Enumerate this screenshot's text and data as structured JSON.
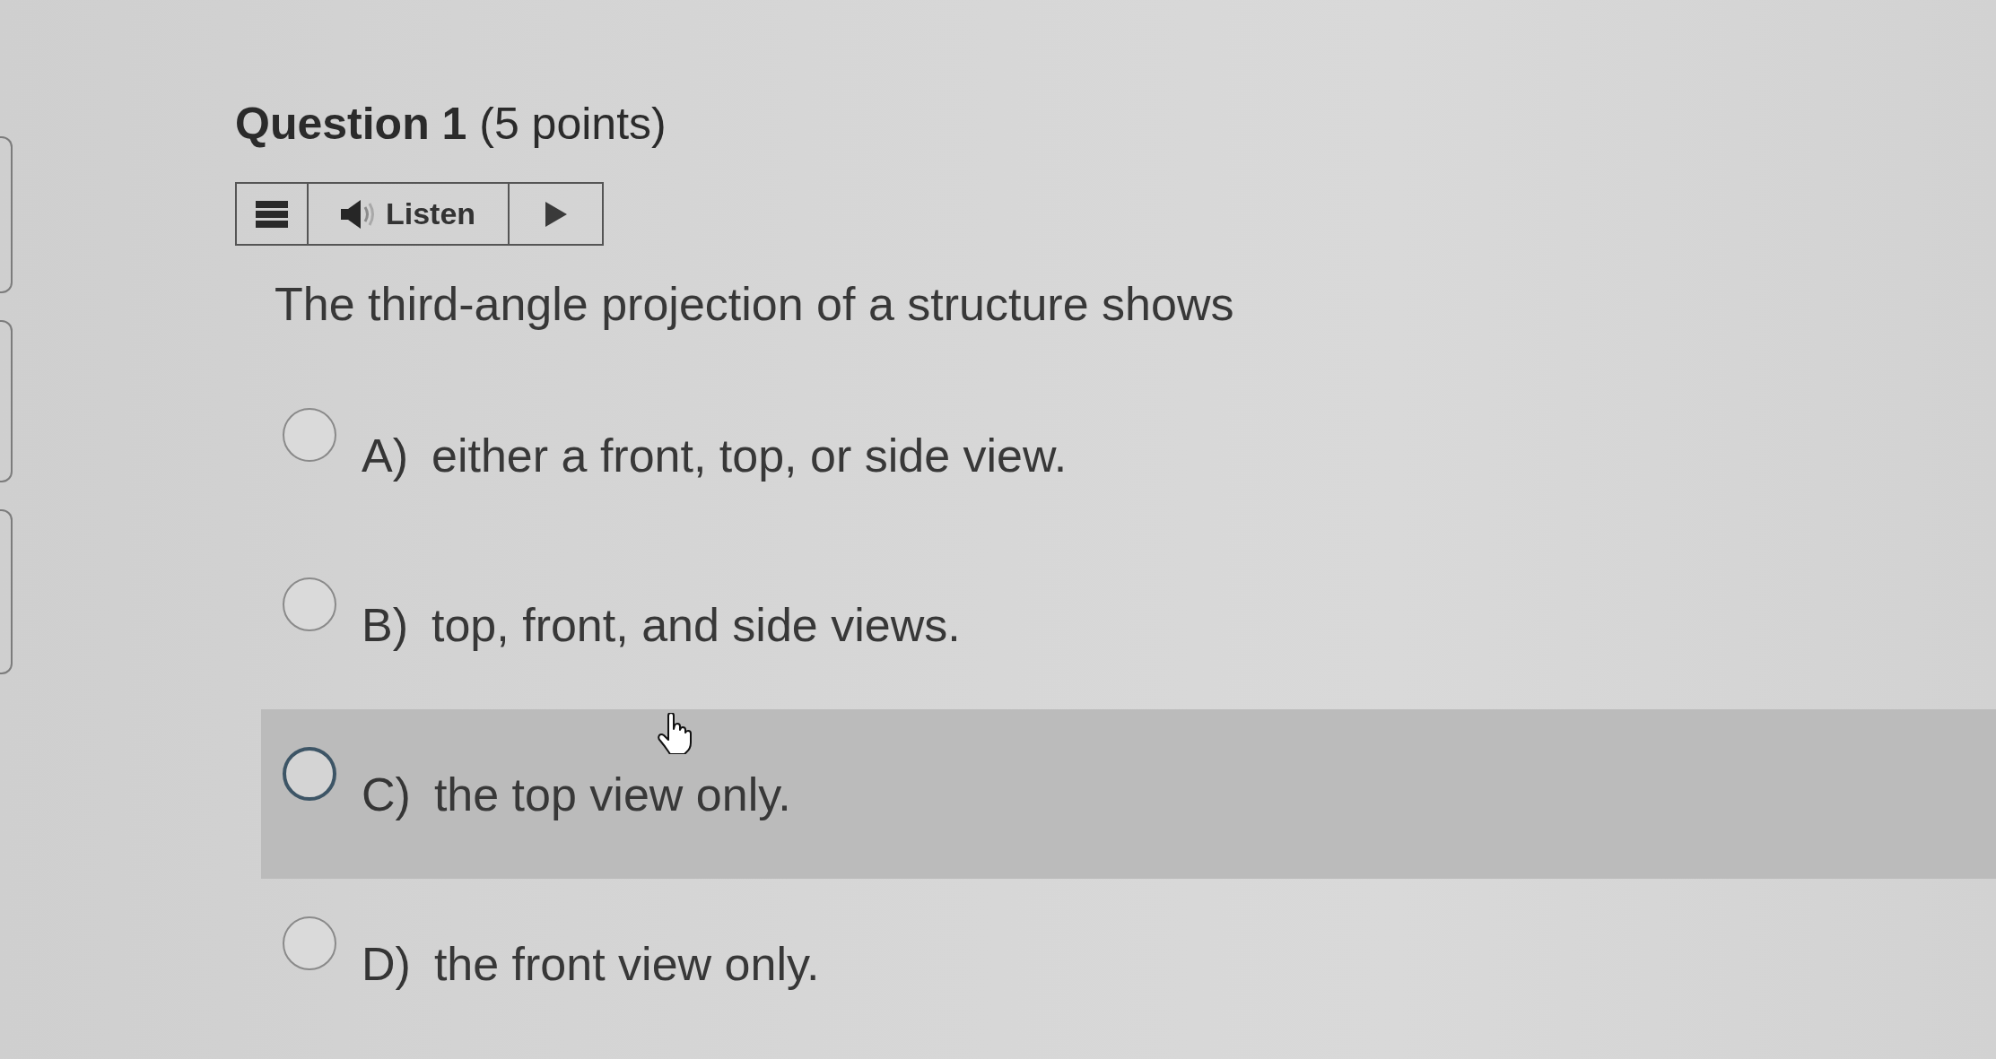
{
  "question": {
    "title": "**Question 1** (5 points)",
    "toolbar": [
      {
        "kind": "menu"
      },
      {
        "kind": "listen",
        "label": "Listen"
      },
      {
        "kind": "play"
      }
    ],
    "prompt": "The third-angle projection of a structure shows",
    "options": [
      {
        "label": "A)",
        "text": "either a front, top, or side view.",
        "selected": false,
        "highlighted": false
      },
      {
        "label": "B)",
        "text": "top, front, and side views.",
        "selected": false,
        "highlighted": false
      },
      {
        "label": "C)",
        "text": "the top view only.",
        "selected": false,
        "highlighted": true
      },
      {
        "label": "D)",
        "text": "the front view only.",
        "selected": false,
        "highlighted": false
      }
    ]
  }
}
